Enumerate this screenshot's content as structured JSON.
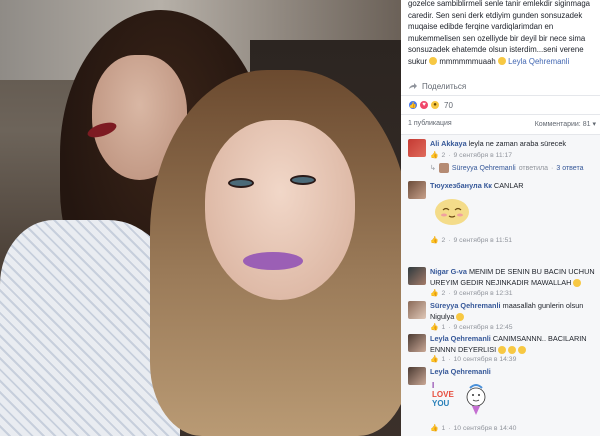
{
  "post": {
    "text_lines": [
      "gozelce sambiblirmeli senle tanir emlekdir siginmaga",
      "caredir. Sen seni derk etdiyim gunden sonsuzadek",
      "muqaise edibde ferqine vardiqlarimdan en",
      "mukemmelisen sen ozelliyde bir deyil bir nece sima",
      "sonsuzadek ehatemde olsun isterdim...seni verene",
      "sukur"
    ],
    "last_line_tail": "mmmmmmuaah",
    "signature": "Leyla Qehremanli",
    "share_label": "Поделиться",
    "reactions_count": "70",
    "publications_label": "1 публикация",
    "comments_label": "Комментарии: 81",
    "reaction_icons": [
      "like-icon",
      "love-icon",
      "wow-icon"
    ]
  },
  "comments": [
    {
      "name": "Ali Akkaya",
      "text": "leyla ne zaman araba sürecek",
      "likes": "2",
      "time": "9 сентября в 11:17",
      "reply": {
        "name": "Süreyya Qehremanli",
        "action": "ответила",
        "count": "3 ответа"
      }
    },
    {
      "name": "Тюухезбанула Кк",
      "text": "CANLAR",
      "likes": "2",
      "time": "9 сентября в 11:51",
      "sticker": "blush-face-sticker"
    },
    {
      "name": "Nigar G-va",
      "text": "MENIM DE SENIN BU BACIN UCHUN UREYIM GEDIR NEJINKADIR MAWALLAH",
      "likes": "2",
      "time": "9 сентября в 12:31"
    },
    {
      "name": "Süreyya Qehremanli",
      "text": "maasallah gunlerin olsun Nigulya",
      "likes": "1",
      "time": "9 сентября в 12:45"
    },
    {
      "name": "Leyla Qehremanli",
      "text": "CANIMSANNN.. BACILARIN ENNNN DEYERLISI",
      "likes": "1",
      "time": "10 сентября в 14:39"
    },
    {
      "name": "Leyla Qehremanli",
      "text": "",
      "likes": "1",
      "time": "10 сентября в 14:40",
      "sticker": "i-love-you-sticker",
      "sticker_text": [
        "I",
        "LOVE",
        "YOU"
      ]
    }
  ],
  "colors": {
    "link": "#365899",
    "meta": "#90949c",
    "like_blue": "#4267b2",
    "comments_bg": "#f6f7f9"
  }
}
